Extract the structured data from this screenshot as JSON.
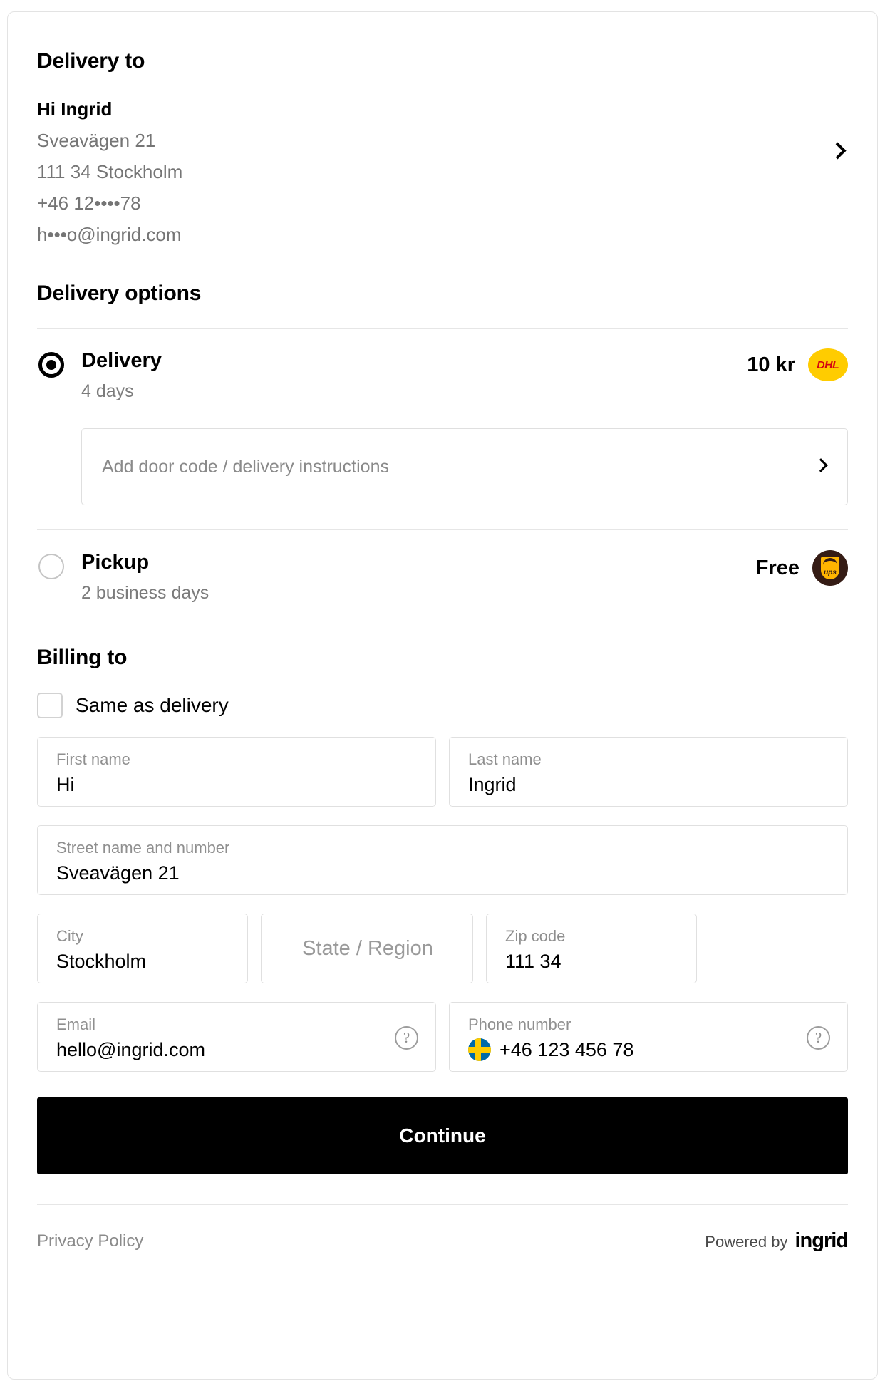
{
  "delivery_to": {
    "heading": "Delivery to",
    "name": "Hi Ingrid",
    "street": "Sveavägen 21",
    "city_line": "111 34 Stockholm",
    "phone_masked": "+46 12••••78",
    "email_masked": "h•••o@ingrid.com",
    "edit_icon": "chevron-right-icon"
  },
  "delivery_options": {
    "heading": "Delivery options",
    "options": [
      {
        "id": "delivery",
        "title": "Delivery",
        "subtitle": "4 days",
        "price": "10 kr",
        "carrier": "DHL",
        "carrier_logo_text": "DHL",
        "selected": true,
        "instructions_label": "Add door code / delivery instructions"
      },
      {
        "id": "pickup",
        "title": "Pickup",
        "subtitle": "2 business days",
        "price": "Free",
        "carrier": "UPS",
        "carrier_logo_text": "ups",
        "selected": false
      }
    ]
  },
  "billing": {
    "heading": "Billing to",
    "same_as_delivery_label": "Same as delivery",
    "same_as_delivery_checked": false,
    "fields": {
      "first_name": {
        "label": "First name",
        "value": "Hi"
      },
      "last_name": {
        "label": "Last name",
        "value": "Ingrid"
      },
      "street": {
        "label": "Street name and number",
        "value": "Sveavägen 21"
      },
      "city": {
        "label": "City",
        "value": "Stockholm"
      },
      "state": {
        "label": "State / Region",
        "placeholder": "State / Region",
        "value": ""
      },
      "zip": {
        "label": "Zip code",
        "value": "111 34"
      },
      "email": {
        "label": "Email",
        "value": "hello@ingrid.com",
        "help_icon": "question-circle-icon"
      },
      "phone": {
        "label": "Phone number",
        "value": "+46 123 456 78",
        "country_flag": "sweden-flag-icon",
        "help_icon": "question-circle-icon"
      }
    }
  },
  "continue_label": "Continue",
  "footer": {
    "privacy_policy": "Privacy Policy",
    "powered_by": "Powered by",
    "brand": "ingrid"
  },
  "colors": {
    "dhl_yellow": "#FFCC00",
    "dhl_red": "#D40511",
    "ups_brown": "#351C15",
    "ups_gold": "#FFB500",
    "flag_blue": "#006AA7",
    "flag_yellow": "#FECC00",
    "button_black": "#000000"
  }
}
